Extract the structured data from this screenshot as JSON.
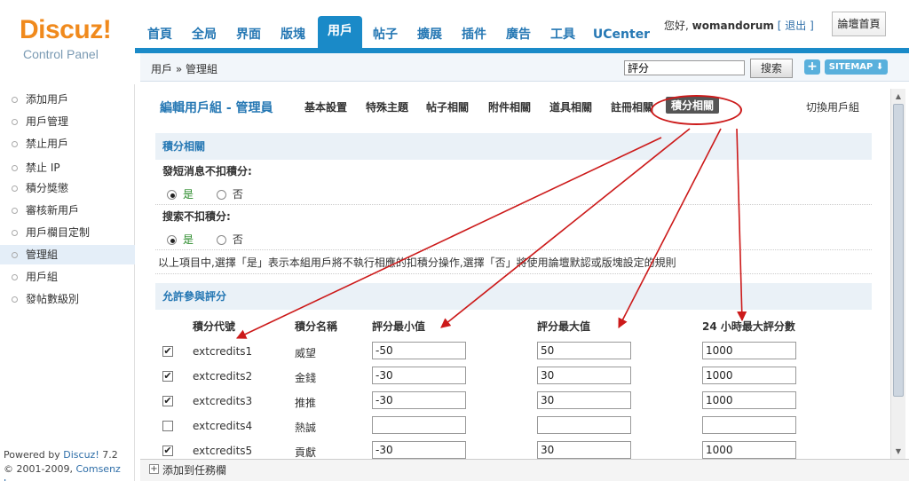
{
  "logo": {
    "brand": "Discuz!",
    "sub": "Control Panel"
  },
  "nav": {
    "tabs": [
      {
        "label": "首頁"
      },
      {
        "label": "全局"
      },
      {
        "label": "界面"
      },
      {
        "label": "版塊"
      },
      {
        "label": "用戶",
        "active": true
      },
      {
        "label": "帖子"
      },
      {
        "label": "擴展"
      },
      {
        "label": "插件"
      },
      {
        "label": "廣告"
      },
      {
        "label": "工具"
      },
      {
        "label": "UCenter"
      }
    ]
  },
  "user": {
    "greeting": "您好,",
    "name": "womandorum",
    "logout": "[ 退出 ]"
  },
  "forum_home_button": "論壇首頁",
  "breadcrumb": "用戶 » 管理組",
  "search": {
    "value": "評分",
    "button": "搜索"
  },
  "plus_label": "+",
  "sitemap_label": "SITEMAP ⬇",
  "sidebar": {
    "items": [
      {
        "label": "添加用戶"
      },
      {
        "label": "用戶管理"
      },
      {
        "label": "禁止用戶"
      },
      {
        "label": "禁止 IP"
      },
      {
        "label": "積分獎懲"
      },
      {
        "label": "審核新用戶"
      },
      {
        "label": "用戶欄目定制"
      },
      {
        "label": "管理組",
        "active": true
      },
      {
        "label": "用戶組"
      },
      {
        "label": "發帖數級別"
      }
    ]
  },
  "powered": {
    "line1_prefix": "Powered by ",
    "line1_brand": "Discuz!",
    "line1_version": " 7.2",
    "line2_prefix": "© 2001-2009, ",
    "line2_brand": "Comsenz Inc."
  },
  "edit": {
    "title": "編輯用戶組 - 管理員",
    "tabs": [
      "基本設置",
      "特殊主題",
      "帖子相關",
      "附件相關",
      "道具相關",
      "註冊相關",
      "積分相關"
    ],
    "active_tab": "積分相關",
    "switch_group": "切換用戶組"
  },
  "credit_section": {
    "heading": "積分相關",
    "q1": "發短消息不扣積分:",
    "q2": "搜索不扣積分:",
    "yes": "是",
    "no": "否",
    "note": "以上項目中,選擇「是」表示本組用戶將不執行相應的扣積分操作,選擇「否」將使用論壇默認或版塊設定的規則"
  },
  "rating_section": {
    "heading": "允許參與評分",
    "columns": [
      "積分代號",
      "積分名稱",
      "評分最小值",
      "評分最大值",
      "24 小時最大評分數"
    ],
    "rows": [
      {
        "checked": true,
        "code": "extcredits1",
        "name": "威望",
        "min": "-50",
        "max": "50",
        "daily": "1000"
      },
      {
        "checked": true,
        "code": "extcredits2",
        "name": "金錢",
        "min": "-30",
        "max": "30",
        "daily": "1000"
      },
      {
        "checked": true,
        "code": "extcredits3",
        "name": "推推",
        "min": "-30",
        "max": "30",
        "daily": "1000"
      },
      {
        "checked": false,
        "code": "extcredits4",
        "name": "熱誠",
        "min": "",
        "max": "",
        "daily": ""
      },
      {
        "checked": true,
        "code": "extcredits5",
        "name": "貢獻",
        "min": "-30",
        "max": "30",
        "daily": "1000"
      }
    ]
  },
  "taskbar": {
    "icon": "+",
    "label": "添加到任務欄"
  },
  "annotation_color": "#cc1a1a",
  "accent_color": "#1a8ac8"
}
